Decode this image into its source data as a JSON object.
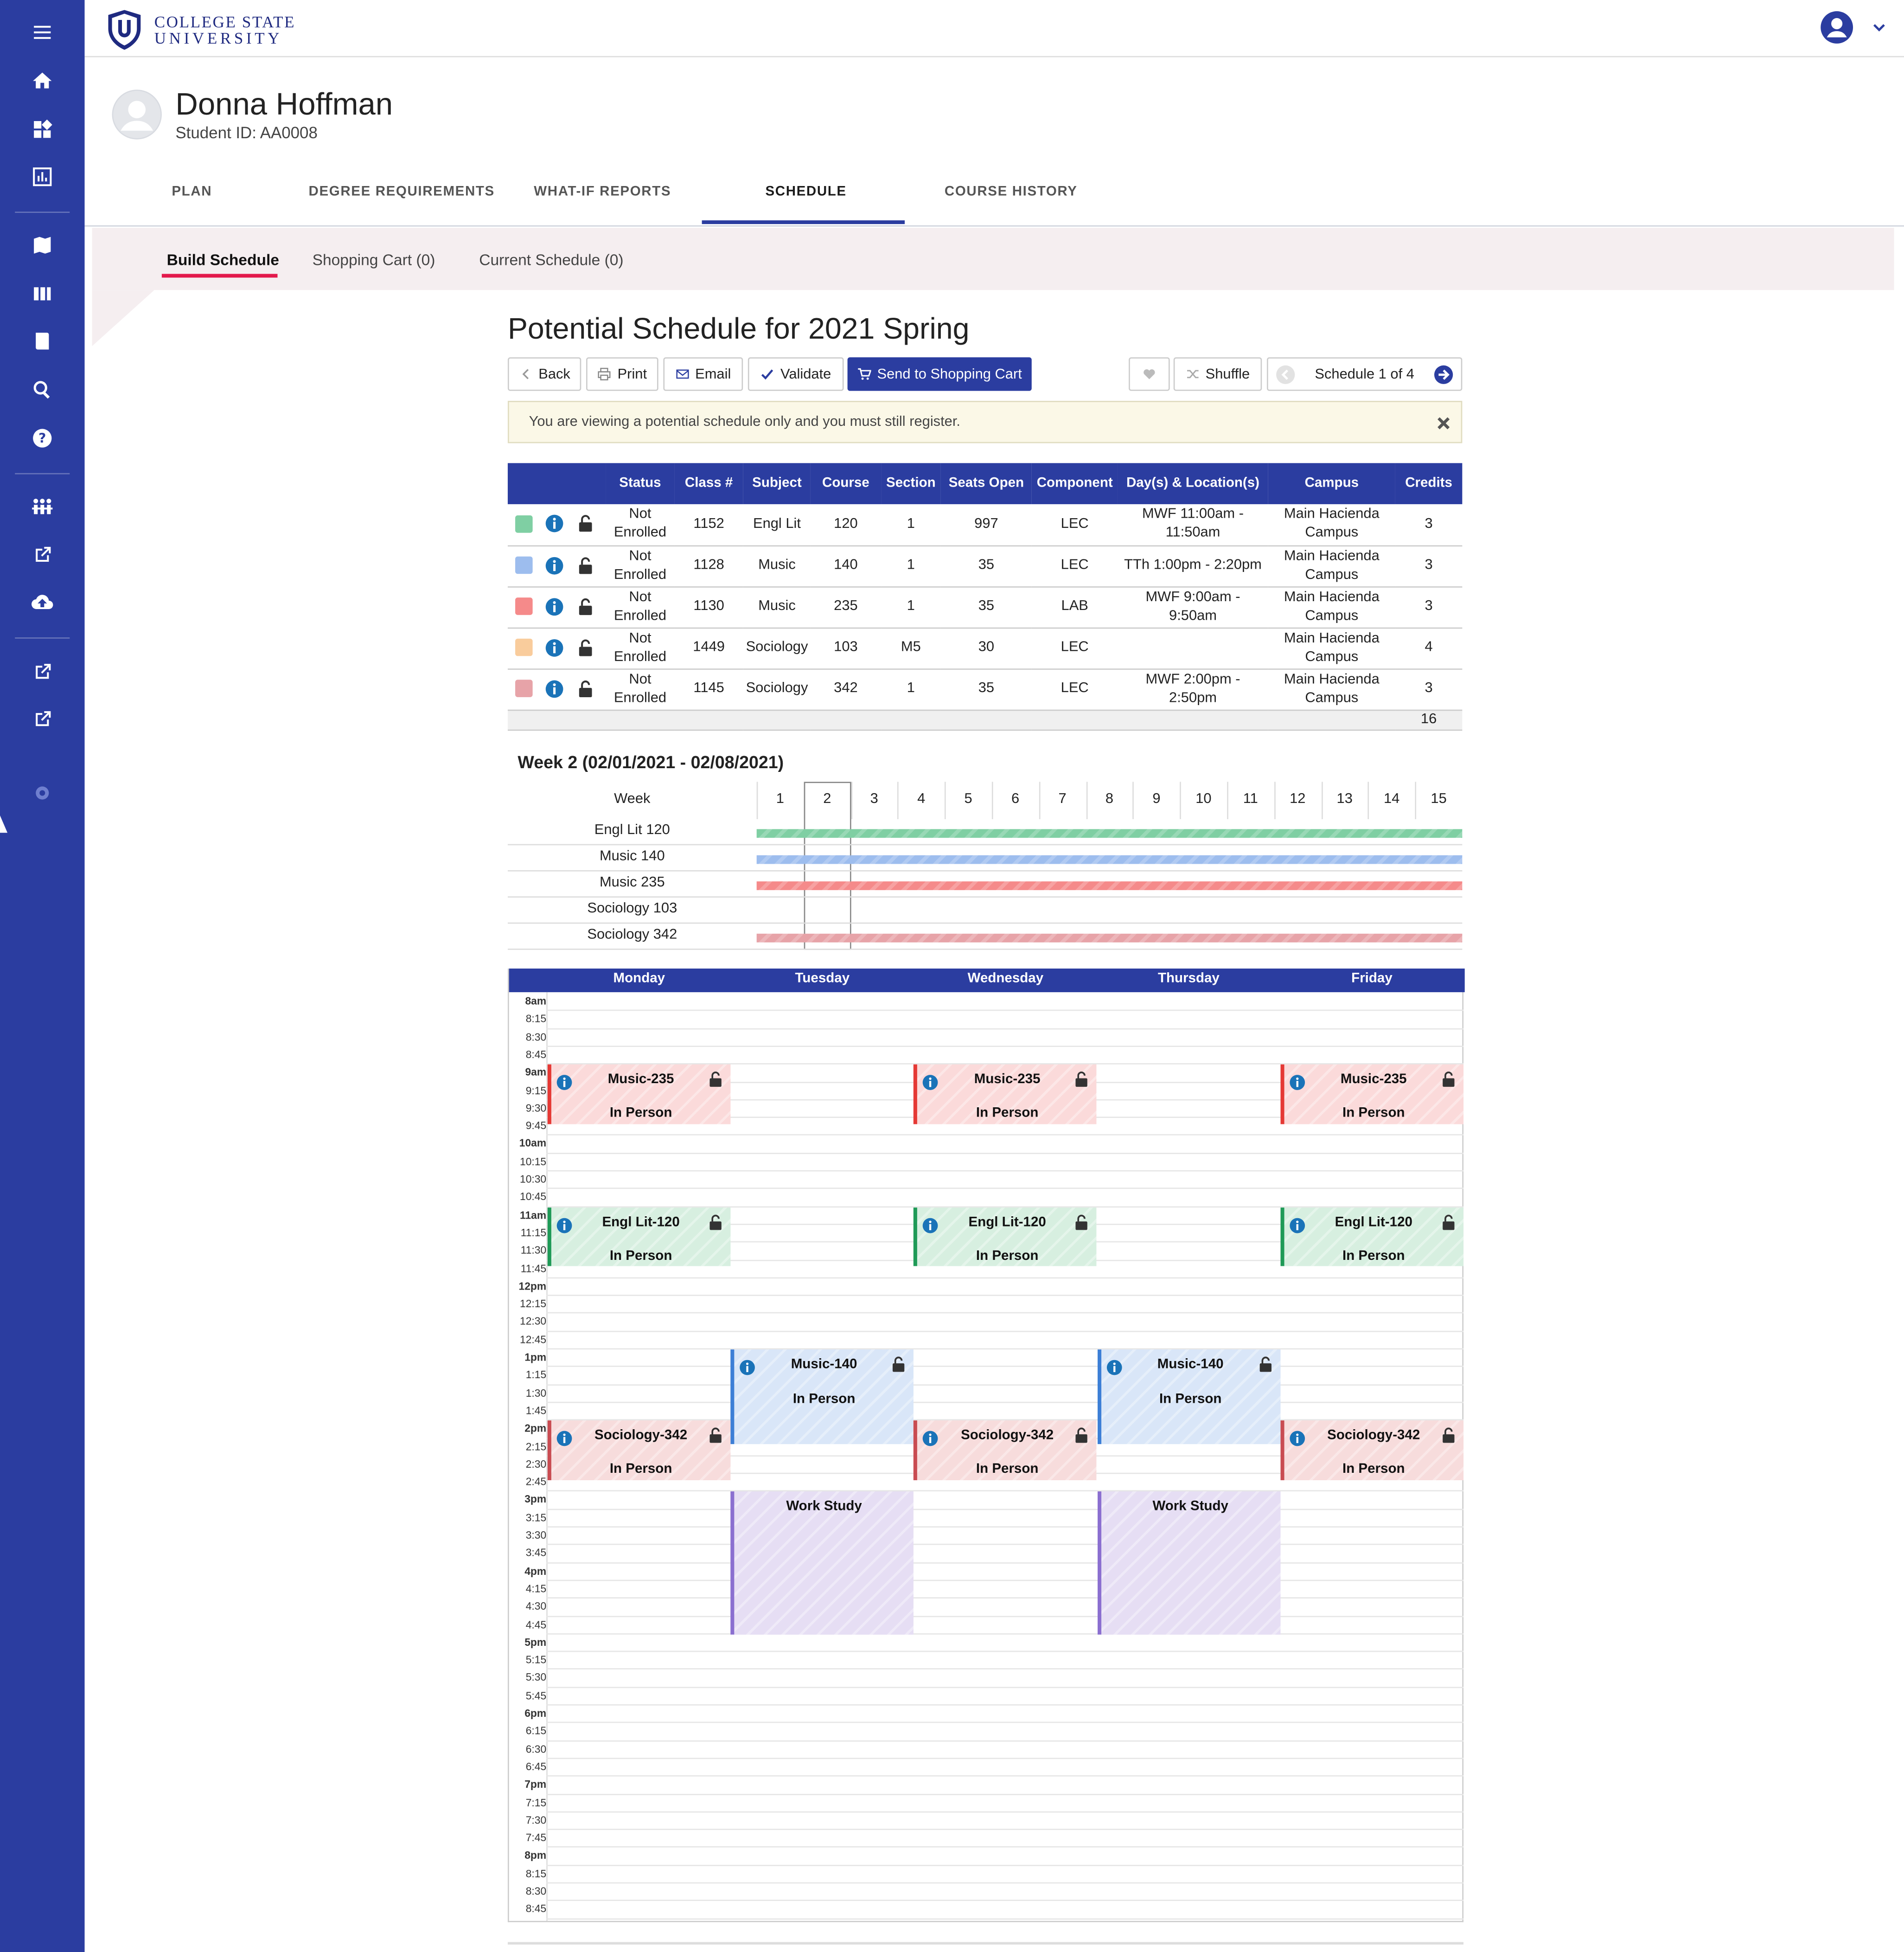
{
  "brand": {
    "line1": "COLLEGE STATE",
    "line2": "UNIVERSITY",
    "color": "#1f2a80"
  },
  "rail_icons": [
    "menu-icon",
    "home-icon",
    "dashboard-icon",
    "chart-icon",
    "map-icon",
    "columns-icon",
    "book-icon",
    "search-icon",
    "help-icon",
    "people-icon",
    "external-link-icon",
    "cloud-upload-icon",
    "external-link-icon",
    "external-link-icon",
    "copyright-icon"
  ],
  "student": {
    "name": "Donna Hoffman",
    "id_text": "Student ID: AA0008"
  },
  "tabs": [
    "PLAN",
    "DEGREE REQUIREMENTS",
    "WHAT-IF REPORTS",
    "SCHEDULE",
    "COURSE HISTORY"
  ],
  "active_tab": "SCHEDULE",
  "subtabs": [
    "Build Schedule",
    "Shopping Cart (0)",
    "Current Schedule (0)"
  ],
  "page_title": "Potential Schedule for 2021 Spring",
  "toolbar": {
    "back": "Back",
    "print": "Print",
    "email": "Email",
    "validate": "Validate",
    "send": "Send to Shopping Cart",
    "shuffle": "Shuffle",
    "schedule_counter": "Schedule 1 of 4"
  },
  "alert_text": "You are viewing a potential schedule only and you must still register.",
  "table": {
    "headers": {
      "status": "Status",
      "class": "Class #",
      "subject": "Subject",
      "course": "Course",
      "section": "Section",
      "seats": "Seats Open",
      "component": "Component",
      "days": "Day(s) & Location(s)",
      "campus": "Campus",
      "credits": "Credits"
    },
    "rows": [
      {
        "color": "#7fcfa3",
        "status": "Not Enrolled",
        "class": "1152",
        "subject": "Engl Lit",
        "course": "120",
        "section": "1",
        "seats": "997",
        "component": "LEC",
        "days": "MWF 11:00am - 11:50am",
        "campus": "Main Hacienda Campus",
        "credits": "3"
      },
      {
        "color": "#9dbdee",
        "status": "Not Enrolled",
        "class": "1128",
        "subject": "Music",
        "course": "140",
        "section": "1",
        "seats": "35",
        "component": "LEC",
        "days": "TTh 1:00pm - 2:20pm",
        "campus": "Main Hacienda Campus",
        "credits": "3"
      },
      {
        "color": "#f58a8a",
        "status": "Not Enrolled",
        "class": "1130",
        "subject": "Music",
        "course": "235",
        "section": "1",
        "seats": "35",
        "component": "LAB",
        "days": "MWF 9:00am - 9:50am",
        "campus": "Main Hacienda Campus",
        "credits": "3"
      },
      {
        "color": "#f9cc9c",
        "status": "Not Enrolled",
        "class": "1449",
        "subject": "Sociology",
        "course": "103",
        "section": "M5",
        "seats": "30",
        "component": "LEC",
        "days": "",
        "campus": "Main Hacienda Campus",
        "credits": "4"
      },
      {
        "color": "#e7a3a8",
        "status": "Not Enrolled",
        "class": "1145",
        "subject": "Sociology",
        "course": "342",
        "section": "1",
        "seats": "35",
        "component": "LEC",
        "days": "MWF 2:00pm - 2:50pm",
        "campus": "Main Hacienda Campus",
        "credits": "3"
      }
    ],
    "total_credits": "16"
  },
  "week_view": {
    "title": "Week 2 (02/01/2021 - 02/08/2021)",
    "week_label": "Week",
    "weeks": [
      "1",
      "2",
      "3",
      "4",
      "5",
      "6",
      "7",
      "8",
      "9",
      "10",
      "11",
      "12",
      "13",
      "14",
      "15"
    ],
    "selected_week": 2,
    "courses": [
      {
        "label": "Engl Lit 120",
        "color": "#7fcfa3",
        "bar": true
      },
      {
        "label": "Music 140",
        "color": "#9dbdee",
        "bar": true
      },
      {
        "label": "Music 235",
        "color": "#f58a8a",
        "bar": true
      },
      {
        "label": "Sociology 103",
        "color": "#f9cc9c",
        "bar": false
      },
      {
        "label": "Sociology 342",
        "color": "#e7a3a8",
        "bar": true
      }
    ]
  },
  "calendar": {
    "days": [
      "Monday",
      "Tuesday",
      "Wednesday",
      "Thursday",
      "Friday"
    ],
    "times": [
      "8am",
      "8:15",
      "8:30",
      "8:45",
      "9am",
      "9:15",
      "9:30",
      "9:45",
      "10am",
      "10:15",
      "10:30",
      "10:45",
      "11am",
      "11:15",
      "11:30",
      "11:45",
      "12pm",
      "12:15",
      "12:30",
      "12:45",
      "1pm",
      "1:15",
      "1:30",
      "1:45",
      "2pm",
      "2:15",
      "2:30",
      "2:45",
      "3pm",
      "3:15",
      "3:30",
      "3:45",
      "4pm",
      "4:15",
      "4:30",
      "4:45",
      "5pm",
      "5:15",
      "5:30",
      "5:45",
      "6pm",
      "6:15",
      "6:30",
      "6:45",
      "7pm",
      "7:15",
      "7:30",
      "7:45",
      "8pm",
      "8:15",
      "8:30",
      "8:45"
    ],
    "events": [
      {
        "title": "Music-235",
        "sub": "In Person",
        "days": [
          0,
          2,
          4
        ],
        "start": "9:00",
        "end": "9:50",
        "fill": "#fbdada",
        "border": "#e53935",
        "icons": true
      },
      {
        "title": "Engl Lit-120",
        "sub": "In Person",
        "days": [
          0,
          2,
          4
        ],
        "start": "11:00",
        "end": "11:50",
        "fill": "#d7efe0",
        "border": "#1f9a57",
        "icons": true
      },
      {
        "title": "Music-140",
        "sub": "In Person",
        "days": [
          1,
          3
        ],
        "start": "13:00",
        "end": "14:20",
        "fill": "#d9e6f8",
        "border": "#3d7fd6",
        "icons": true
      },
      {
        "title": "Sociology-342",
        "sub": "In Person",
        "days": [
          0,
          2,
          4
        ],
        "start": "14:00",
        "end": "14:50",
        "fill": "#f7dcdc",
        "border": "#c94c52",
        "icons": true
      },
      {
        "title": "Work Study",
        "sub": "",
        "days": [
          1,
          3
        ],
        "start": "15:00",
        "end": "17:00",
        "fill": "#e6def4",
        "border": "#8b6fd0",
        "icons": false
      }
    ]
  }
}
